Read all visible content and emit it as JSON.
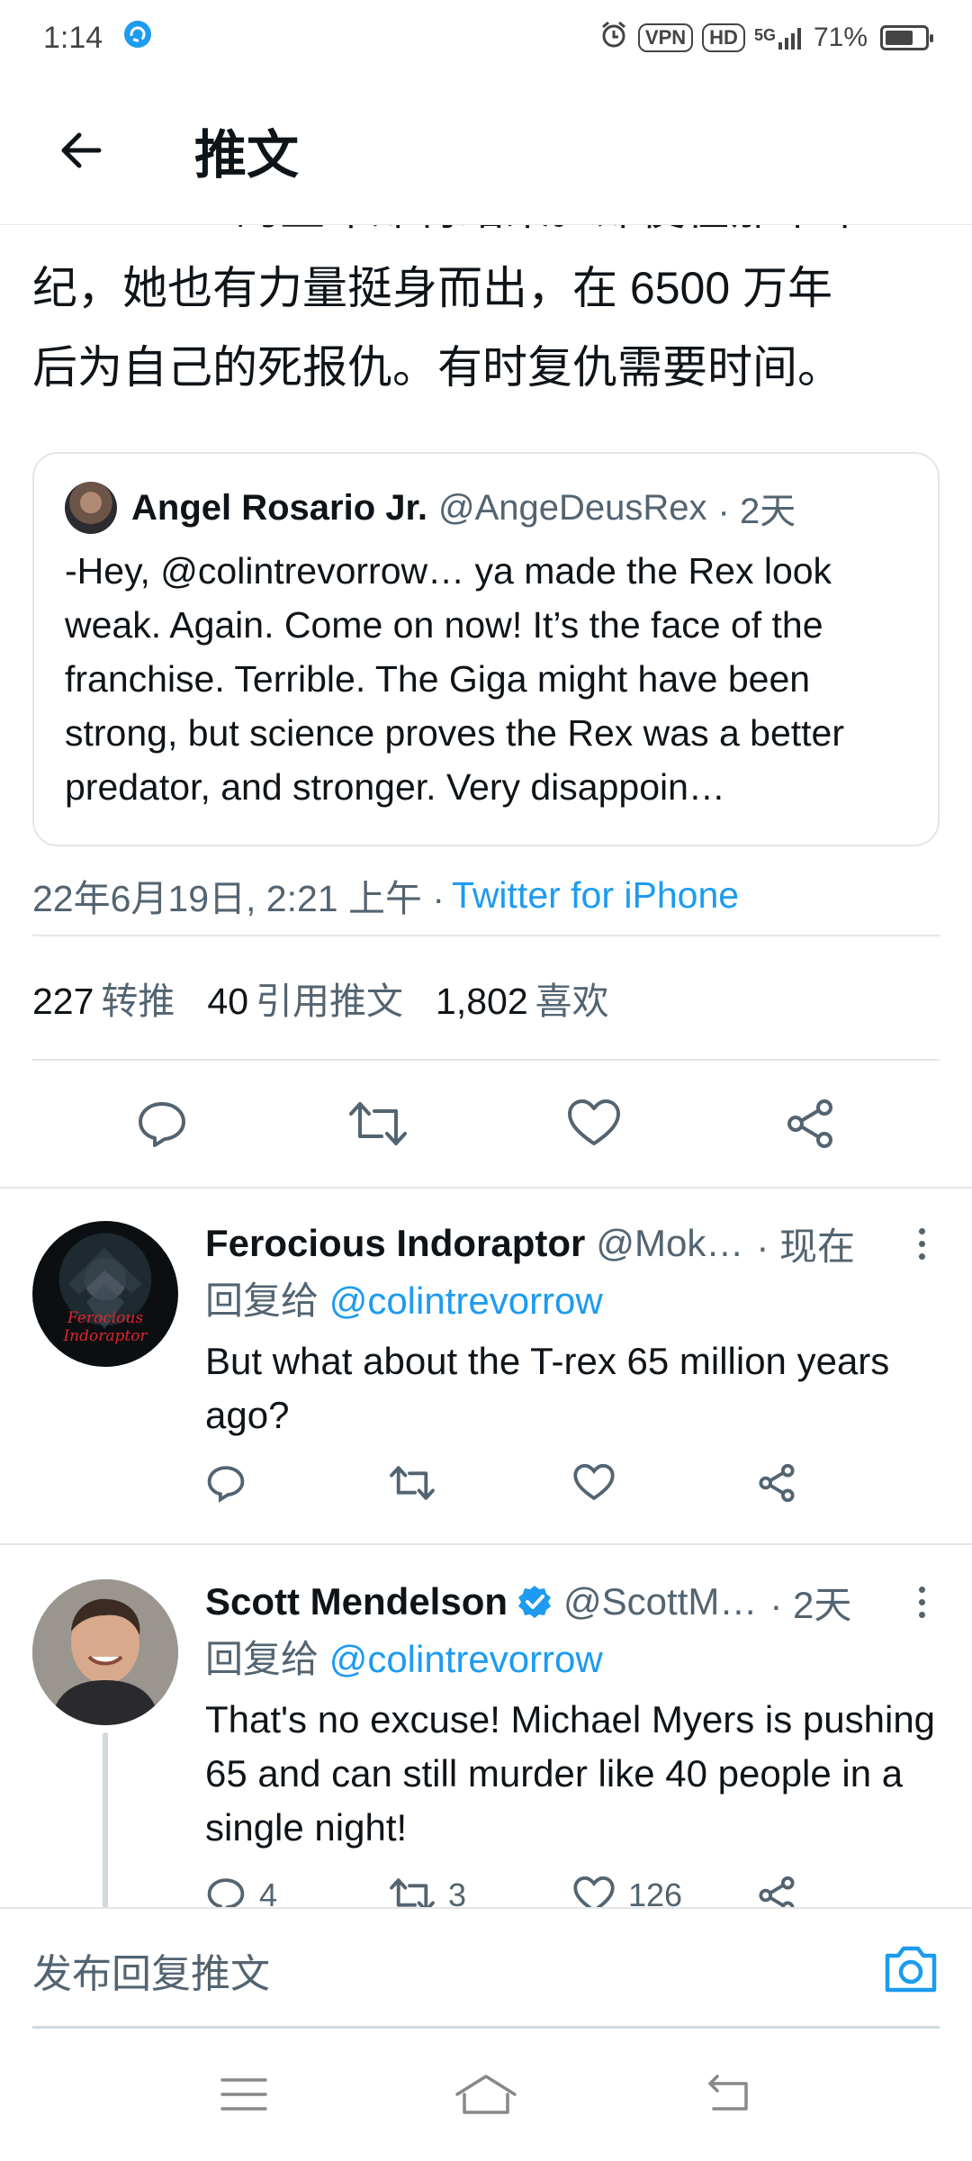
{
  "status_bar": {
    "time": "1:14",
    "vpn": "VPN",
    "hd": "HD",
    "network": "5G",
    "battery": "71%",
    "battery_level": 0.71
  },
  "header": {
    "title": "推文"
  },
  "tweet": {
    "text_lines": [
      "Dominion 的生命即将结束。即使在那个年",
      "纪，她也有力量挺身而出，在 6500 万年",
      "后为自己的死报仇。有时复仇需要时间。"
    ],
    "quote": {
      "name": "Angel Rosario Jr.",
      "handle": "@AngeDeusRex",
      "time": "· 2天",
      "text": "-Hey, @colintrevorrow… ya made the Rex look weak. Again. Come on now! It’s the face of the franchise. Terrible. The Giga might have been strong, but science proves the Rex was a better predator, and stronger. Very disappoin…"
    },
    "datetime": "22年6月19日, 2:21 上午 ·",
    "source": "Twitter for iPhone",
    "stats": {
      "retweets_num": "227",
      "retweets_label": "转推",
      "quotes_num": "40",
      "quotes_label": "引用推文",
      "likes_num": "1,802",
      "likes_label": "喜欢"
    }
  },
  "replies": [
    {
      "name": "Ferocious Indoraptor",
      "handle": "@Mok…",
      "time": "· 现在",
      "reply_to_label": "回复给",
      "reply_to": "@colintrevorrow",
      "text": "But what about the T-rex 65 million years ago?",
      "avatar_text": "Ferocious Indoraptor",
      "counts": {
        "reply": "",
        "retweet": "",
        "like": ""
      }
    },
    {
      "name": "Scott Mendelson",
      "handle": "@ScottM…",
      "time": "· 2天",
      "reply_to_label": "回复给",
      "reply_to": "@colintrevorrow",
      "text": "That's no excuse! Michael Myers is pushing 65 and can still murder like 40 people in a single night!",
      "counts": {
        "reply": "4",
        "retweet": "3",
        "like": "126"
      }
    }
  ],
  "composer": {
    "placeholder": "发布回复推文"
  },
  "colors": {
    "accent": "#1d9bf0",
    "text": "#0f1419",
    "secondary": "#536471",
    "divider": "#e6e6e6"
  }
}
